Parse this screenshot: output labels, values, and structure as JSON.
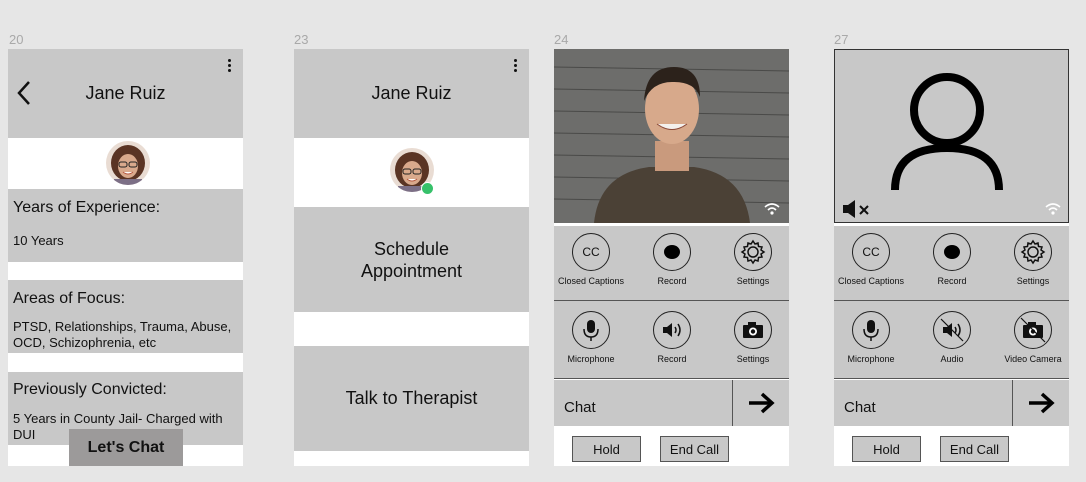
{
  "frames": [
    {
      "number": "20"
    },
    {
      "number": "23"
    },
    {
      "number": "24"
    },
    {
      "number": "27"
    }
  ],
  "profile": {
    "therapist_name": "Jane Ruiz",
    "experience_heading": "Years of Experience:",
    "experience_value": "10 Years",
    "focus_heading": "Areas of Focus:",
    "focus_value": "PTSD, Relationships, Trauma, Abuse, OCD, Schizophrenia, etc",
    "convicted_heading": "Previously Convicted:",
    "convicted_value": "5 Years in County Jail- Charged with DUI",
    "chat_button": "Let's Chat"
  },
  "options": {
    "therapist_name": "Jane Ruiz",
    "schedule_button": "Schedule Appointment",
    "talk_button": "Talk to Therapist",
    "online_color": "#36c16a"
  },
  "video_call": {
    "controls_row1": [
      "Closed Captions",
      "Record",
      "Settings"
    ],
    "controls_row2": [
      "Microphone",
      "Record",
      "Settings"
    ],
    "cc_text": "CC",
    "chat_label": "Chat",
    "hold_button": "Hold",
    "end_call_button": "End Call"
  },
  "audio_call": {
    "controls_row1": [
      "Closed Captions",
      "Record",
      "Settings"
    ],
    "controls_row2": [
      "Microphone",
      "Audio",
      "Video Camera"
    ],
    "cc_text": "CC",
    "chat_label": "Chat",
    "hold_button": "Hold",
    "end_call_button": "End Call"
  }
}
